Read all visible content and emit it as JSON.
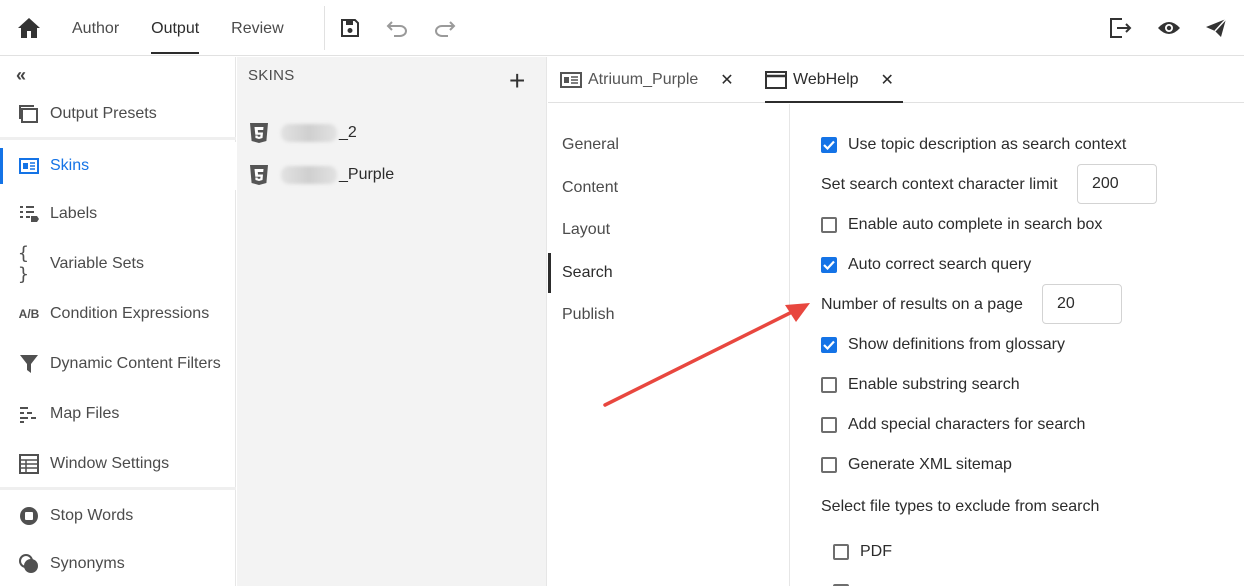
{
  "topbar": {
    "tabs": [
      {
        "label": "Author"
      },
      {
        "label": "Output"
      },
      {
        "label": "Review"
      }
    ]
  },
  "sidebar": {
    "collapse_glyph": "«",
    "items": [
      {
        "label": "Output Presets",
        "icon": "output-presets-icon"
      },
      {
        "label": "Skins",
        "icon": "skins-icon"
      },
      {
        "label": "Labels",
        "icon": "labels-icon"
      },
      {
        "label": "Variable Sets",
        "icon": "braces-icon"
      },
      {
        "label": "Condition Expressions",
        "icon": "ab-icon"
      },
      {
        "label": "Dynamic Content Filters",
        "icon": "filter-icon"
      },
      {
        "label": "Map Files",
        "icon": "map-files-icon"
      },
      {
        "label": "Window Settings",
        "icon": "table-icon"
      },
      {
        "label": "Stop Words",
        "icon": "stop-icon"
      },
      {
        "label": "Synonyms",
        "icon": "synonyms-icon"
      }
    ],
    "ab_text": "A/B"
  },
  "skins_panel": {
    "header": "SKINS",
    "add_glyph": "+",
    "items": [
      {
        "suffix": "_2"
      },
      {
        "suffix": "_Purple"
      }
    ]
  },
  "doc_tabs": [
    {
      "label": "Atriuum_Purple",
      "close": "✕"
    },
    {
      "label": "WebHelp",
      "close": "✕"
    }
  ],
  "settings_nav": [
    {
      "label": "General"
    },
    {
      "label": "Content"
    },
    {
      "label": "Layout"
    },
    {
      "label": "Search"
    },
    {
      "label": "Publish"
    }
  ],
  "search_settings": {
    "use_topic_description": {
      "label": "Use topic description as search context",
      "checked": true
    },
    "context_limit": {
      "label": "Set search context character limit",
      "value": "200"
    },
    "auto_complete": {
      "label": "Enable auto complete in search box",
      "checked": false
    },
    "auto_correct": {
      "label": "Auto correct search query",
      "checked": true
    },
    "results_per_page": {
      "label": "Number of results on a page",
      "value": "20"
    },
    "show_definitions": {
      "label": "Show definitions from glossary",
      "checked": true
    },
    "substring_search": {
      "label": "Enable substring search",
      "checked": false
    },
    "special_characters": {
      "label": "Add special characters for search",
      "checked": false
    },
    "xml_sitemap": {
      "label": "Generate XML sitemap",
      "checked": false
    },
    "exclude_types_label": "Select file types to exclude from search",
    "file_types": [
      {
        "label": "PDF",
        "checked": false
      }
    ]
  },
  "colors": {
    "accent": "#1473e6",
    "annotation_arrow": "#e8473f"
  }
}
